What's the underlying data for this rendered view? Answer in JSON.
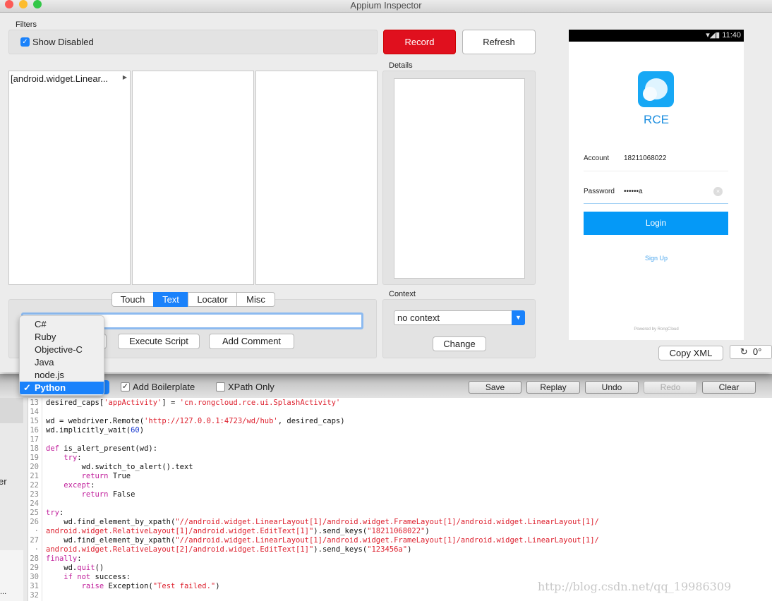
{
  "window": {
    "title": "Appium Inspector"
  },
  "filters": {
    "label": "Filters",
    "show_disabled": "Show Disabled",
    "show_disabled_checked": true
  },
  "buttons": {
    "record": "Record",
    "refresh": "Refresh",
    "execute_script": "Execute Script",
    "add_comment": "Add Comment",
    "change": "Change",
    "copy_xml": "Copy XML",
    "rotation": "0°"
  },
  "tree": {
    "col1_item": "[android.widget.Linear..."
  },
  "details": {
    "label": "Details"
  },
  "tabs": [
    {
      "label": "Touch"
    },
    {
      "label": "Text",
      "active": true
    },
    {
      "label": "Locator"
    },
    {
      "label": "Misc"
    }
  ],
  "context": {
    "label": "Context",
    "value": "no context"
  },
  "text_input": {
    "value": ""
  },
  "language_menu": {
    "items": [
      "C#",
      "Ruby",
      "Objective-C",
      "Java",
      "node.js",
      "Python"
    ],
    "selected": "Python"
  },
  "code_toolbar": {
    "add_boilerplate": "Add Boilerplate",
    "add_boilerplate_checked": true,
    "xpath_only": "XPath Only",
    "xpath_only_checked": false,
    "save": "Save",
    "replay": "Replay",
    "undo": "Undo",
    "redo": "Redo",
    "clear": "Clear"
  },
  "colors": {
    "record": "#e0101e",
    "accent": "#1a82fb",
    "phone_blue": "#0599f7",
    "keyword": "#c01c9a",
    "string": "#dd1e2c",
    "number": "#1a3ad0"
  },
  "code": [
    {
      "n": "13",
      "s": [
        [
          "p",
          "desired_caps["
        ],
        [
          "str",
          "'appActivity'"
        ],
        [
          "p",
          "] = "
        ],
        [
          "str",
          "'cn.rongcloud.rce.ui.SplashActivity'"
        ]
      ]
    },
    {
      "n": "14",
      "s": []
    },
    {
      "n": "15",
      "s": [
        [
          "p",
          "wd = webdriver.Remote("
        ],
        [
          "str",
          "'http://127.0.0.1:4723/wd/hub'"
        ],
        [
          "p",
          ", desired_caps)"
        ]
      ]
    },
    {
      "n": "16",
      "s": [
        [
          "p",
          "wd.implicitly_wait("
        ],
        [
          "num",
          "60"
        ],
        [
          "p",
          ")"
        ]
      ]
    },
    {
      "n": "17",
      "s": []
    },
    {
      "n": "18",
      "s": [
        [
          "kw",
          "def"
        ],
        [
          "p",
          " is_alert_present(wd):"
        ]
      ]
    },
    {
      "n": "19",
      "s": [
        [
          "p",
          "    "
        ],
        [
          "kw",
          "try"
        ],
        [
          "p",
          ":"
        ]
      ]
    },
    {
      "n": "20",
      "s": [
        [
          "p",
          "        wd.switch_to_alert().text"
        ]
      ]
    },
    {
      "n": "21",
      "s": [
        [
          "p",
          "        "
        ],
        [
          "kw",
          "return"
        ],
        [
          "p",
          " True"
        ]
      ]
    },
    {
      "n": "22",
      "s": [
        [
          "p",
          "    "
        ],
        [
          "kw",
          "except"
        ],
        [
          "p",
          ":"
        ]
      ]
    },
    {
      "n": "23",
      "s": [
        [
          "p",
          "        "
        ],
        [
          "kw",
          "return"
        ],
        [
          "p",
          " False"
        ]
      ]
    },
    {
      "n": "24",
      "s": []
    },
    {
      "n": "25",
      "s": [
        [
          "kw",
          "try"
        ],
        [
          "p",
          ":"
        ]
      ]
    },
    {
      "n": "26",
      "s": [
        [
          "p",
          "    wd.find_element_by_xpath("
        ],
        [
          "str",
          "\"//android.widget.LinearLayout[1]/android.widget.FrameLayout[1]/android.widget.LinearLayout[1]/"
        ]
      ]
    },
    {
      "n": "·",
      "s": [
        [
          "str",
          "android.widget.RelativeLayout[1]/android.widget.EditText[1]\""
        ],
        [
          "p",
          ").send_keys("
        ],
        [
          "str",
          "\"18211068022\""
        ],
        [
          "p",
          ")"
        ]
      ]
    },
    {
      "n": "27",
      "s": [
        [
          "p",
          "    wd.find_element_by_xpath("
        ],
        [
          "str",
          "\"//android.widget.LinearLayout[1]/android.widget.FrameLayout[1]/android.widget.LinearLayout[1]/"
        ]
      ]
    },
    {
      "n": "·",
      "s": [
        [
          "str",
          "android.widget.RelativeLayout[2]/android.widget.EditText[1]\""
        ],
        [
          "p",
          ").send_keys("
        ],
        [
          "str",
          "\"123456a\""
        ],
        [
          "p",
          ")"
        ]
      ]
    },
    {
      "n": "28",
      "s": [
        [
          "kw",
          "finally"
        ],
        [
          "p",
          ":"
        ]
      ]
    },
    {
      "n": "29",
      "s": [
        [
          "p",
          "    wd."
        ],
        [
          "kw",
          "quit"
        ],
        [
          "p",
          "()"
        ]
      ]
    },
    {
      "n": "30",
      "s": [
        [
          "p",
          "    "
        ],
        [
          "kw",
          "if not"
        ],
        [
          "p",
          " success:"
        ]
      ]
    },
    {
      "n": "31",
      "s": [
        [
          "p",
          "        "
        ],
        [
          "kw",
          "raise"
        ],
        [
          "p",
          " Exception("
        ],
        [
          "str",
          "\"Test failed.\""
        ],
        [
          "p",
          ")"
        ]
      ]
    },
    {
      "n": "32",
      "s": []
    }
  ],
  "background_window": {
    "fragment": "er",
    "ellipsis": "..."
  },
  "watermark": "http://blog.csdn.net/qq_19986309",
  "phone": {
    "time": "11:40",
    "app_name": "RCE",
    "account_label": "Account",
    "account_value": "18211068022",
    "password_label": "Password",
    "password_value": "••••••a",
    "login": "Login",
    "sign_up": "Sign Up",
    "powered_by": "Powered by RongCloud"
  }
}
